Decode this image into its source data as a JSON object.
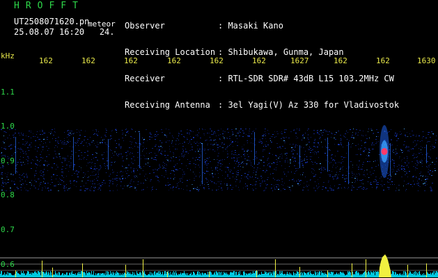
{
  "header": {
    "brand": "HROFFT",
    "filename": "UT2508071620.pn",
    "suffix": "meteor",
    "timestamp": "25.08.07 16:20   24."
  },
  "station": [
    {
      "label": "Observer",
      "value": ": Masaki Kano"
    },
    {
      "label": "Receiving Location",
      "value": ": Shibukawa, Gunma, Japan"
    },
    {
      "label": "Receiver",
      "value": ": RTL-SDR SDR# 43dB L15 103.2MHz CW"
    },
    {
      "label": "Receiving Antenna",
      "value": ": 3el Yagi(V) Az 330 for Vladivostok"
    }
  ],
  "axes": {
    "unit": "kHz",
    "freq_ticks": [
      "162",
      "162",
      "162",
      "162",
      "162",
      "162",
      "1627",
      "162",
      "162",
      "1630"
    ],
    "y_ticks": [
      "1.1",
      "1.0",
      "0.9",
      "0.8",
      "0.7",
      "0.6"
    ]
  },
  "spectrogram": {
    "band_y_range": [
      0.82,
      0.96
    ],
    "meteor_echo_center_khz": 0.92,
    "meteor_echo_column_fraction": 0.88,
    "colors": {
      "background": "#000000",
      "noise": "#1a3fd0",
      "echo_core": "#ff3a6a",
      "echo_halo": "#2a8bff",
      "trace": "#00c8e0",
      "peak": "#f0f040",
      "text_green": "#2ed84a",
      "tick_yellow": "#e8e84a"
    }
  }
}
